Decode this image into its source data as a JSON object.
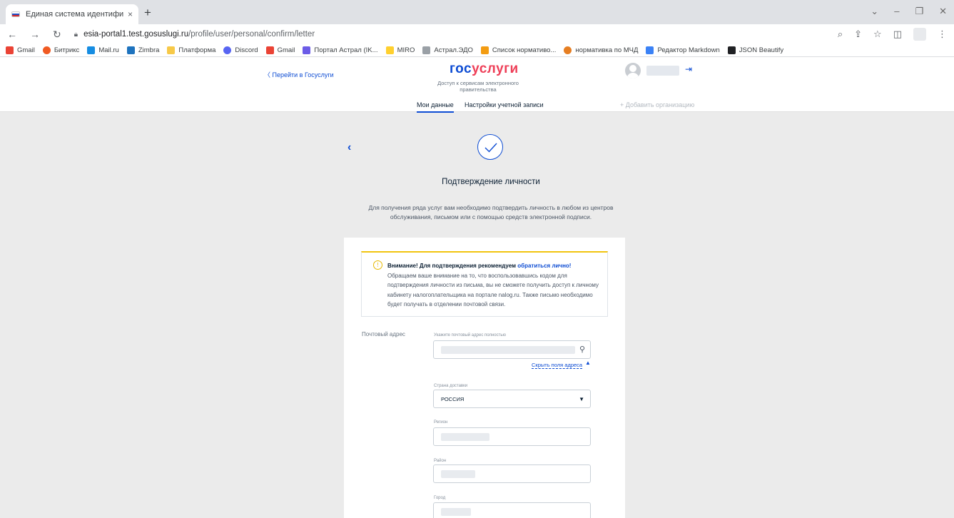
{
  "browser": {
    "tab_title": "Единая система идентификации",
    "tab_close": "×",
    "new_tab": "+",
    "url_host": "esia-portal1.test.gosuslugi.ru",
    "url_path": "/profile/user/personal/confirm/letter",
    "bookmarks": [
      {
        "label": "Gmail",
        "color": "#ea4335"
      },
      {
        "label": "Битрикс",
        "color": "#f05a22"
      },
      {
        "label": "Mail.ru",
        "color": "#168de2"
      },
      {
        "label": "Zimbra",
        "color": "#1e73be"
      },
      {
        "label": "Платформа",
        "color": "#f7c948"
      },
      {
        "label": "Discord",
        "color": "#5865f2"
      },
      {
        "label": "Gmail",
        "color": "#ea4335"
      },
      {
        "label": "Портал Астрал (IK...",
        "color": "#6c5ce7"
      },
      {
        "label": "MIRO",
        "color": "#ffd02f"
      },
      {
        "label": "Астрал.ЭДО",
        "color": "#9aa0a6"
      },
      {
        "label": "Список нормативо...",
        "color": "#f39c12"
      },
      {
        "label": "нормативка по МЧД",
        "color": "#e67e22"
      },
      {
        "label": "Редактор Markdown",
        "color": "#3b82f6"
      },
      {
        "label": "JSON Beautify",
        "color": "#202124"
      }
    ]
  },
  "header": {
    "back_link": "〈 Перейти в Госуслуги",
    "logo_part1": "гос",
    "logo_part2": "услуги",
    "logo_sub": "Доступ к сервисам электронного правительства",
    "tabs": [
      "Мои данные",
      "Настройки учетной записи"
    ],
    "add_org": "+ Добавить организацию"
  },
  "main": {
    "back": "‹",
    "title": "Подтверждение личности",
    "intro": "Для получения ряда услуг вам необходимо подтвердить личность в любом из центров обслуживания, письмом или с помощью средств электронной подписи.",
    "warning_title": "Внимание! Для подтверждения рекомендуем ",
    "warning_link": "обратиться лично!",
    "warning_text": "Обращаем ваше внимание на то, что воспользовавшись кодом для подтверждения личности из письма, вы не сможете получить доступ к личному кабинету налогоплательщика на портале nalog.ru. Также письмо необходимо будет получать в отделении почтовой связи.",
    "address_label": "Почтовый адрес",
    "full_address_label": "Укажите почтовый адрес полностью",
    "hide_fields": "Скрыть поля адреса",
    "country_label": "Страна доставки",
    "country_value": "РОССИЯ",
    "region_label": "Регион",
    "district_label": "Район",
    "city_label": "Город"
  }
}
